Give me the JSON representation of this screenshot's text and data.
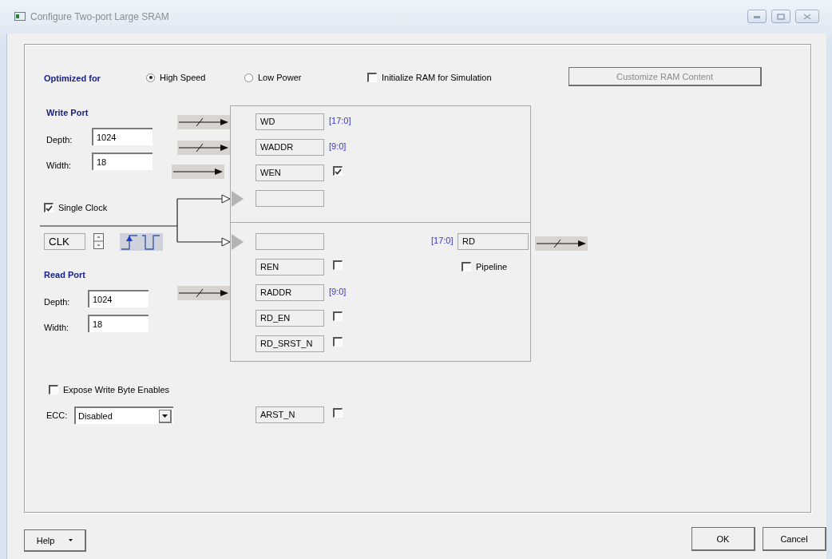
{
  "window": {
    "title": "Configure Two-port Large SRAM"
  },
  "optimized_for": {
    "label": "Optimized for",
    "options": [
      {
        "label": "High Speed",
        "selected": true
      },
      {
        "label": "Low Power",
        "selected": false
      }
    ]
  },
  "init_ram": {
    "label": "Initialize RAM for Simulation",
    "checked": false
  },
  "customize_button": {
    "label": "Customize RAM Content",
    "disabled": true
  },
  "write_port": {
    "title": "Write Port",
    "depth": {
      "label": "Depth:",
      "value": "1024"
    },
    "width": {
      "label": "Width:",
      "value": "18"
    }
  },
  "single_clock": {
    "label": "Single Clock",
    "checked": true
  },
  "clock": {
    "value": "CLK"
  },
  "read_port": {
    "title": "Read Port",
    "depth": {
      "label": "Depth:",
      "value": "1024"
    },
    "width": {
      "label": "Width:",
      "value": "18"
    }
  },
  "write_signals": [
    {
      "kind": "bus",
      "name": "WD",
      "range": "[17:0]"
    },
    {
      "kind": "bus",
      "name": "WADDR",
      "range": "[9:0]"
    },
    {
      "kind": "enable",
      "name": "WEN",
      "checked": true
    },
    {
      "kind": "clock"
    }
  ],
  "read_signals": [
    {
      "kind": "clock"
    },
    {
      "kind": "control",
      "name": "REN",
      "checked": false
    },
    {
      "kind": "bus",
      "name": "RADDR",
      "range": "[9:0]"
    },
    {
      "kind": "control",
      "name": "RD_EN",
      "checked": false
    },
    {
      "kind": "control",
      "name": "RD_SRST_N",
      "checked": false
    }
  ],
  "read_output": {
    "range": "[17:0]",
    "name": "RD"
  },
  "pipeline": {
    "label": "Pipeline",
    "checked": false
  },
  "expose_byte_enables": {
    "label": "Expose Write Byte Enables",
    "checked": false
  },
  "ecc": {
    "label": "ECC:",
    "value": "Disabled"
  },
  "async_reset": {
    "name": "ARST_N",
    "checked": false
  },
  "buttons": {
    "help": "Help",
    "ok": "OK",
    "cancel": "Cancel"
  }
}
